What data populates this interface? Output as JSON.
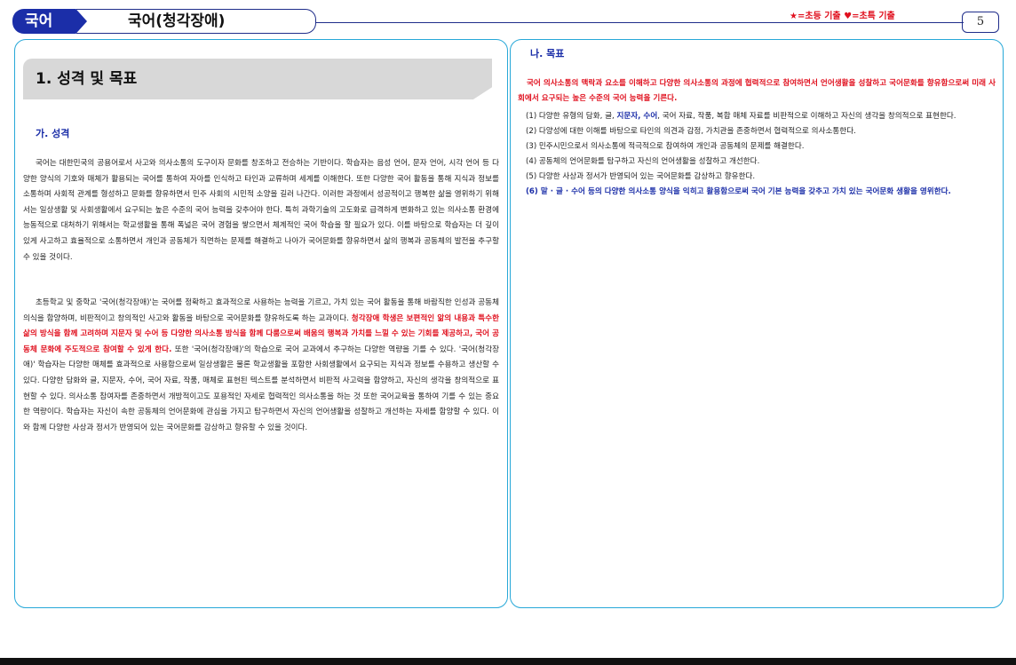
{
  "header": {
    "subject": "국어",
    "title": "국어(청각장애)",
    "legend": "★=초등 기출 ♥=초특 기출",
    "page_number": "5"
  },
  "left": {
    "section_title": "1. 성격 및 목표",
    "subsection_title": "가. 성격",
    "para1": "국어는 대한민국의 공용어로서 사고와 의사소통의 도구이자 문화를 창조하고 전승하는 기반이다. 학습자는 음성 언어, 문자 언어, 시각 언어 등 다양한 양식의 기호와 매체가 활용되는 국어를 통하여 자아를 인식하고 타인과 교류하며 세계를 이해한다. 또한 다양한 국어 활동을 통해 지식과 정보를 소통하며 사회적 관계를 형성하고 문화를 향유하면서 민주 사회의 시민적 소양을 길러 나간다. 이러한 과정에서 성공적이고 행복한 삶을 영위하기 위해서는 일상생활 및 사회생활에서 요구되는 높은 수준의 국어 능력을 갖추어야 한다. 특히 과학기술의 고도화로 급격하게 변화하고 있는 의사소통 환경에 능동적으로 대처하기 위해서는 학교생활을 통해 폭넓은 국어 경험을 쌓으면서 체계적인 국어 학습을 할 필요가 있다. 이를 바탕으로 학습자는 더 깊이 있게 사고하고 효율적으로 소통하면서 개인과 공동체가 직면하는 문제를 해결하고 나아가 국어문화를 향유하면서 삶의 행복과 공동체의 발전을 추구할 수 있을 것이다.",
    "para2_a": "초등학교 및 중학교 '국어(청각장애)'는 국어를 정확하고 효과적으로 사용하는 능력을 기르고, 가치 있는 국어 활동을 통해 바람직한 인성과 공동체 의식을 함양하며, 비판적이고 창의적인 사고와 활동을 바탕으로 국어문화를 향유하도록 하는 교과이다.",
    "para2_highlight": "청각장애 학생은 보편적인 앎의 내용과 특수한 삶의 방식을 함께 고려하며 지문자 및 수어 등 다양한 의사소통 방식을 함께 다룸으로써 배움의 행복과 가치를 느낄 수 있는 기회를 제공하고, 국어 공동체 문화에 주도적으로 참여할 수 있게 한다.",
    "para2_b": "또한 '국어(청각장애)'의 학습으로 국어 교과에서 추구하는 다양한 역량을 기를 수 있다. '국어(청각장애)' 학습자는 다양한 매체를 효과적으로 사용함으로써 일상생활은 물론 학교생활을 포함한 사회생활에서 요구되는 지식과 정보를 수용하고 생산할 수 있다. 다양한 담화와 글, 지문자, 수어, 국어 자료, 작품, 매체로 표현된 텍스트를 분석하면서 비판적 사고력을 함양하고, 자신의 생각을 창의적으로 표현할 수 있다. 의사소통 참여자를 존중하면서 개방적이고도 포용적인 자세로 협력적인 의사소통을 하는 것 또한 국어교육을 통하여 기를 수 있는 중요한 역량이다. 학습자는 자신이 속한 공동체의 언어문화에 관심을 가지고 탐구하면서 자신의 언어생활을 성찰하고 개선하는 자세를 함양할 수 있다. 이와 함께 다양한 사상과 정서가 반영되어 있는 국어문화를 감상하고 향유할 수 있을 것이다."
  },
  "right": {
    "subsection_title": "나. 목표",
    "lead": "국어 의사소통의 맥락과 요소를 이해하고 다양한 의사소통의 과정에 협력적으로 참여하면서 언어생활을 성찰하고 국어문화를 향유함으로써 미래 사회에서 요구되는 높은 수준의 국어 능력을 기른다.",
    "goal1_a": "(1) 다양한 유형의 담화, 글, ",
    "goal1_hl": "지문자, 수어",
    "goal1_b": ", 국어 자료, 작품, 복합 매체 자료를 비판적으로 이해하고 자신의 생각을 창의적으로 표현한다.",
    "goal2": "(2) 다양성에 대한 이해를 바탕으로 타인의 의견과 감정, 가치관을 존중하면서 협력적으로 의사소통한다.",
    "goal3": "(3) 민주시민으로서 의사소통에 적극적으로 참여하여 개인과 공동체의 문제를 해결한다.",
    "goal4": "(4) 공동체의 언어문화를 탐구하고 자신의 언어생활을 성찰하고 개선한다.",
    "goal5": "(5) 다양한 사상과 정서가 반영되어 있는 국어문화를 감상하고 향유한다.",
    "goal6": "(6) 말 · 글 · 수어 등의 다양한 의사소통 양식을 익히고 활용함으로써 국어 기본 능력을 갖추고 가치 있는 국어문화 생활을 영위한다."
  },
  "colors": {
    "accent_blue": "#1b2ea8",
    "highlight_red": "#e0101e",
    "column_border": "#27a8d8"
  }
}
